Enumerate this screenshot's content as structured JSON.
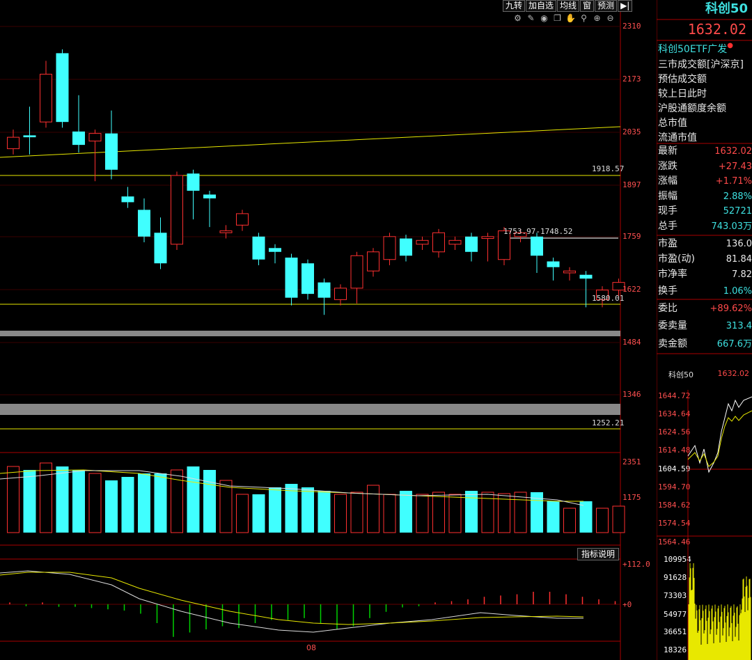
{
  "toolbar": {
    "b1": "九转",
    "b2": "加自选",
    "b3": "均线",
    "b4": "窗",
    "b5": "预测",
    "b6": "▶|"
  },
  "icons": [
    "gear-icon",
    "pen-icon",
    "eye-icon",
    "copy-icon",
    "hand-icon",
    "search-icon",
    "zoom-in-icon",
    "zoom-out-icon"
  ],
  "axis": {
    "price": [
      "2310",
      "2173",
      "2035",
      "1897",
      "1759",
      "1622",
      "1484",
      "1346"
    ],
    "volume": [
      "2351",
      "1175"
    ],
    "macd": [
      "+112.0",
      "+0"
    ],
    "xlabel": "08"
  },
  "annotations": {
    "hline1": "1918.57",
    "hline2": "1580.01",
    "hline3": "1252.21",
    "range": "1753.97-1748.52"
  },
  "indicator_button": "指标说明",
  "panel": {
    "title": "科创50",
    "price": "1632.02",
    "etf": "科创50ETF广发",
    "info": [
      "三市成交额[沪深京]",
      "预估成交额",
      "较上日此时",
      "沪股通额度余额",
      "总市值",
      "流通市值"
    ],
    "rows": [
      {
        "label": "最新",
        "value": "1632.02",
        "color": "#ff4a4a"
      },
      {
        "label": "涨跌",
        "value": "+27.43",
        "color": "#ff4a4a"
      },
      {
        "label": "涨幅",
        "value": "+1.71%",
        "color": "#ff4a4a"
      },
      {
        "label": "振幅",
        "value": "2.88%",
        "color": "#3ee0e0"
      },
      {
        "label": "现手",
        "value": "52721",
        "color": "#3ee0e0"
      },
      {
        "label": "总手",
        "value": "743.03万",
        "color": "#3ee0e0"
      },
      {
        "label": "市盈",
        "value": "136.0",
        "color": "#e8e8e8"
      },
      {
        "label": "市盈(动)",
        "value": "81.84",
        "color": "#e8e8e8"
      },
      {
        "label": "市净率",
        "value": "7.82",
        "color": "#e8e8e8"
      },
      {
        "label": "换手",
        "value": "1.06%",
        "color": "#3ee0e0"
      },
      {
        "label": "委比",
        "value": "+89.62%",
        "color": "#ff4a4a"
      },
      {
        "label": "委卖量",
        "value": "313.4",
        "color": "#3ee0e0"
      },
      {
        "label": "卖金额",
        "value": "667.6万",
        "color": "#3ee0e0"
      }
    ],
    "mini": {
      "name": "科创50",
      "price": "1632.02",
      "price_axis": [
        "1644.72",
        "1634.64",
        "1624.56",
        "1614.48",
        "1604.59",
        "1594.70",
        "1584.62",
        "1574.54",
        "1564.46"
      ],
      "vol_axis": [
        "109954",
        "91628",
        "73303",
        "54977",
        "36651",
        "18326"
      ]
    }
  },
  "chart_data": {
    "type": "candlestick",
    "candles": [
      [
        1990,
        2030,
        1990,
        2020,
        0
      ],
      [
        2020,
        2090,
        1990,
        2025,
        1
      ],
      [
        2185,
        2210,
        2080,
        2060,
        0
      ],
      [
        2060,
        2220,
        2070,
        2240,
        1
      ],
      [
        2035,
        2120,
        1995,
        2000,
        1
      ],
      [
        2010,
        2020,
        1920,
        2030,
        0
      ],
      [
        2030,
        2080,
        1925,
        1935,
        1
      ],
      [
        1865,
        1880,
        1860,
        1850,
        1
      ],
      [
        1830,
        1850,
        1790,
        1760,
        1
      ],
      [
        1770,
        1800,
        1735,
        1690,
        1
      ],
      [
        1740,
        1900,
        1740,
        1920,
        0
      ],
      [
        1880,
        1870,
        1820,
        1925,
        1
      ],
      [
        1870,
        1820,
        1800,
        1860,
        1
      ],
      [
        1770,
        1780,
        1800,
        1775,
        0
      ],
      [
        1790,
        1820,
        1790,
        1820,
        0
      ],
      [
        1760,
        1740,
        1740,
        1700,
        1
      ],
      [
        1720,
        1700,
        1705,
        1730,
        1
      ],
      [
        1705,
        1650,
        1595,
        1600,
        1
      ],
      [
        1690,
        1690,
        1650,
        1610,
        1
      ],
      [
        1640,
        1590,
        1570,
        1600,
        1
      ],
      [
        1595,
        1620,
        1600,
        1625,
        0
      ],
      [
        1625,
        1680,
        1600,
        1710,
        0
      ],
      [
        1670,
        1695,
        1680,
        1720,
        0
      ],
      [
        1700,
        1750,
        1700,
        1760,
        0
      ],
      [
        1710,
        1740,
        1740,
        1755,
        1
      ],
      [
        1740,
        1745,
        1740,
        1750,
        0
      ],
      [
        1720,
        1740,
        1755,
        1770,
        0
      ],
      [
        1750,
        1725,
        1760,
        1740,
        0
      ],
      [
        1720,
        1755,
        1710,
        1760,
        1
      ],
      [
        1755,
        1720,
        1710,
        1760,
        0
      ],
      [
        1700,
        1770,
        1725,
        1775,
        0
      ],
      [
        1770,
        1770,
        1760,
        1760,
        0
      ],
      [
        1760,
        1695,
        1680,
        1710,
        1
      ],
      [
        1695,
        1660,
        1660,
        1680,
        1
      ],
      [
        1665,
        1660,
        1660,
        1670,
        0
      ],
      [
        1650,
        1600,
        1590,
        1660,
        1
      ],
      [
        1595,
        1610,
        1590,
        1620,
        0
      ],
      [
        1620,
        1630,
        1620,
        1640,
        0
      ]
    ]
  }
}
